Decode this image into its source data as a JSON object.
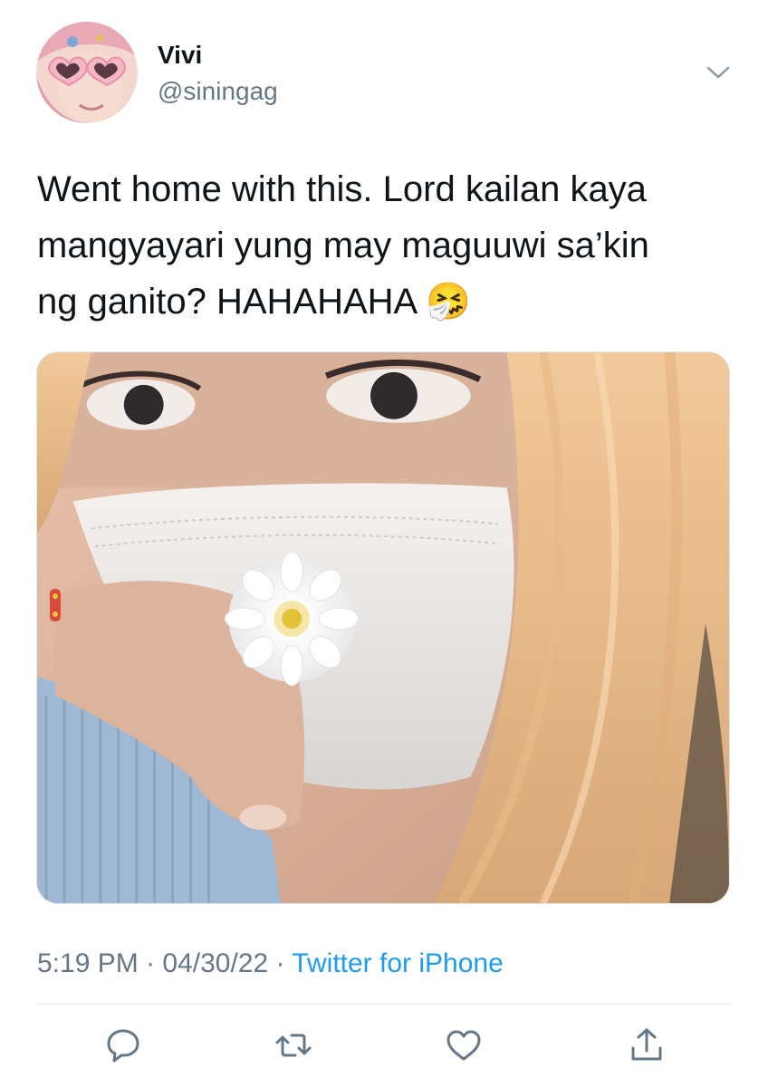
{
  "author": {
    "display_name": "Vivi",
    "handle": "@siningag"
  },
  "tweet": {
    "text": "Went home with this. Lord kailan kaya\nmangyayari yung may maguuwi sa’kin\nng ganito? HAHAHAHA 🤧"
  },
  "meta": {
    "time": "5:19 PM",
    "separator": " · ",
    "date": "04/30/22",
    "source": "Twitter for iPhone"
  },
  "icons": {
    "menu": "chevron-down-icon",
    "reply": "reply-icon",
    "retweet": "retweet-icon",
    "like": "heart-icon",
    "share": "share-icon"
  },
  "colors": {
    "link": "#1d9bf0",
    "secondary_text": "#657786",
    "icon": "#657786",
    "divider": "#e1e8ed"
  }
}
